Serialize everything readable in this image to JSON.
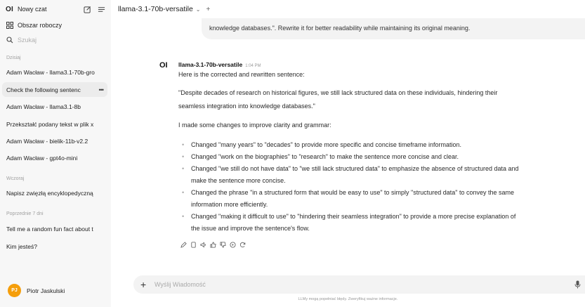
{
  "sidebar": {
    "logo": "OI",
    "new_chat_label": "Nowy czat",
    "workspace_label": "Obszar roboczy",
    "search_placeholder": "Szukaj",
    "sections": [
      {
        "title": "Dzisiaj",
        "chats": [
          "Adam Wacław - llama3.1-70b-gro",
          "Check the following sentenc",
          "Adam Wacław - llama3.1-8b",
          "Przekształć podany tekst w plik x",
          "Adam Wacław - bielik-11b-v2.2",
          "Adam Wacław - gpt4o-mini"
        ]
      },
      {
        "title": "Wczoraj",
        "chats": [
          "Napisz zwięzłą encyklopedyczną"
        ]
      },
      {
        "title": "Poprzednie 7 dni",
        "chats": [
          "Tell me a random fun fact about t",
          "Kim jesteś?"
        ]
      }
    ],
    "active_chat_more": "•••",
    "user": {
      "initials": "PJ",
      "name": "Piotr Jaskulski"
    }
  },
  "header": {
    "model_name": "llama-3.1-70b-versatile",
    "chevron": "⌄",
    "add": "+"
  },
  "user_message": "knowledge databases.\". Rewrite it for better readability while maintaining its original meaning.",
  "assistant": {
    "logo": "OI",
    "name": "llama-3.1-70b-versatile",
    "time": "1:04 PM",
    "intro": "Here is the corrected and rewritten sentence:",
    "quote_line1": "\"Despite decades of research on historical figures, we still lack structured data on these individuals, hindering their",
    "quote_line2": "seamless integration into knowledge databases.\"",
    "changes_intro": "I made some changes to improve clarity and grammar:",
    "bullets": [
      "Changed \"many years\" to \"decades\" to provide more specific and concise timeframe information.",
      "Changed \"work on the biographies\" to \"research\" to make the sentence more concise and clear.",
      "Changed \"we still do not have data\" to \"we still lack structured data\" to emphasize the absence of structured data and",
      "make the sentence more concise.",
      "Changed the phrase \"in a structured form that would be easy to use\" to simply \"structured data\" to convey the same",
      "information more efficiently.",
      "Changed \"making it difficult to use\" to \"hindering their seamless integration\" to provide a more precise explanation of",
      "the issue and improve the sentence's flow."
    ]
  },
  "composer": {
    "add": "+",
    "placeholder": "Wyślij Wiadomość"
  },
  "footer_note": "LLMy mogą popełniać błędy. Zweryfikuj ważne informacje.",
  "colors": {
    "sidebar_bg": "#f7f7f7",
    "active_item": "#ececec",
    "avatar": "#f59e0b",
    "bubble": "#f3f3f3"
  }
}
